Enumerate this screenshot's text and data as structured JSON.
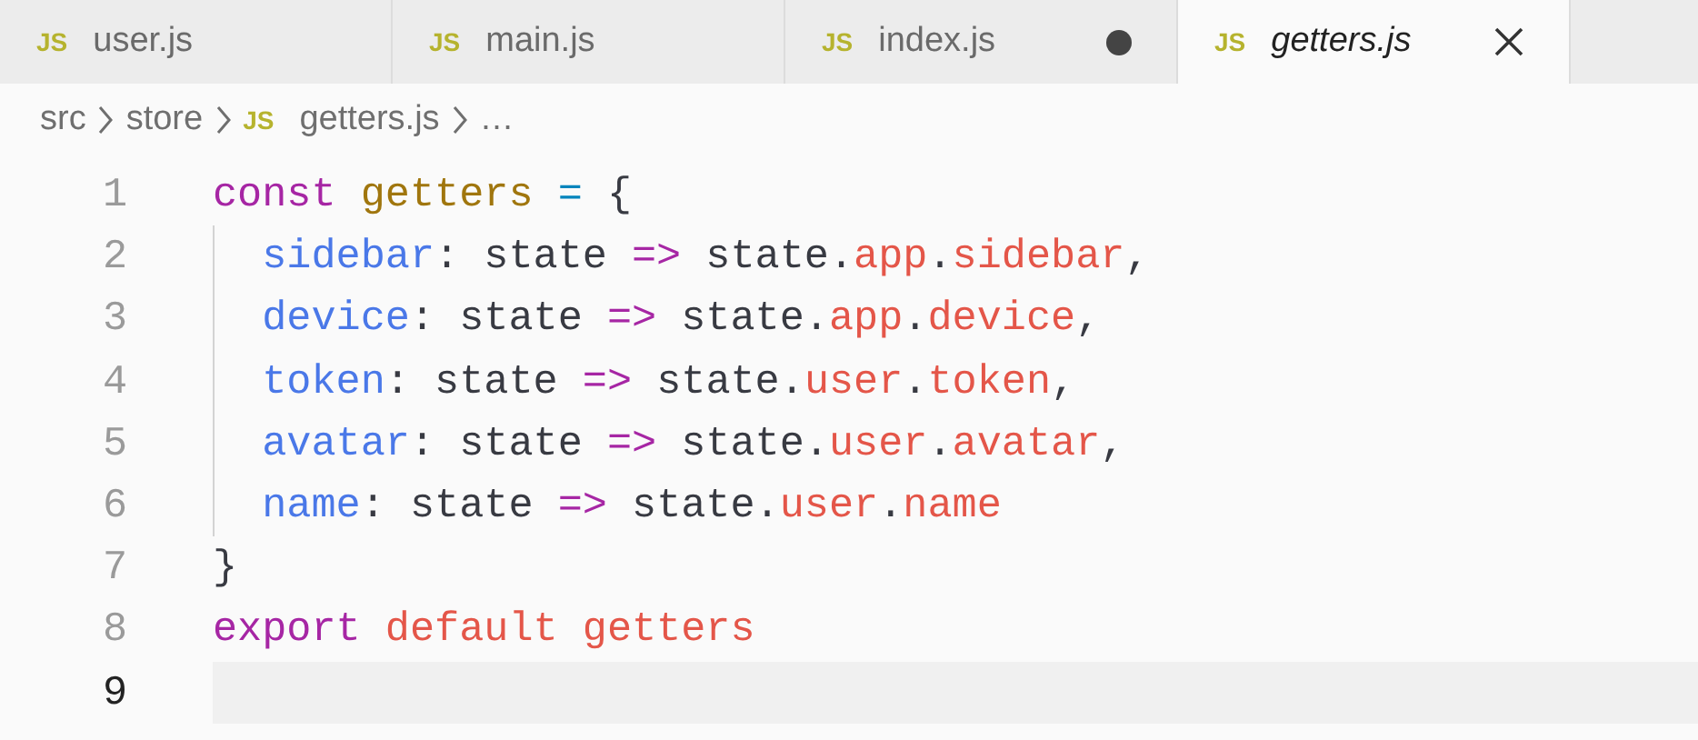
{
  "tabs": [
    {
      "icon": "JS",
      "label": "user.js",
      "selected": false,
      "dirty": false,
      "preview": false
    },
    {
      "icon": "JS",
      "label": "main.js",
      "selected": false,
      "dirty": false,
      "preview": false
    },
    {
      "icon": "JS",
      "label": "index.js",
      "selected": false,
      "dirty": true,
      "preview": false
    },
    {
      "icon": "JS",
      "label": "getters.js",
      "selected": true,
      "dirty": false,
      "preview": true
    }
  ],
  "breadcrumb": [
    {
      "kind": "folder",
      "label": "src"
    },
    {
      "kind": "folder",
      "label": "store"
    },
    {
      "kind": "file",
      "icon": "JS",
      "label": "getters.js"
    },
    {
      "kind": "more",
      "label": "…"
    }
  ],
  "editor": {
    "lines": [
      {
        "number": "1",
        "current": false,
        "tokens": [
          {
            "kind": "keyword",
            "text": "const"
          },
          {
            "kind": "entity",
            "text": " getters"
          },
          {
            "kind": "operator",
            "text": " ="
          },
          {
            "kind": "plain",
            "text": " {"
          }
        ]
      },
      {
        "number": "2",
        "current": false,
        "tokens": [
          {
            "kind": "property",
            "text": "  sidebar"
          },
          {
            "kind": "plain",
            "text": ": state "
          },
          {
            "kind": "keyword",
            "text": "=>"
          },
          {
            "kind": "plain",
            "text": " state."
          },
          {
            "kind": "variable",
            "text": "app"
          },
          {
            "kind": "plain",
            "text": "."
          },
          {
            "kind": "variable",
            "text": "sidebar"
          },
          {
            "kind": "plain",
            "text": ","
          }
        ]
      },
      {
        "number": "3",
        "current": false,
        "tokens": [
          {
            "kind": "property",
            "text": "  device"
          },
          {
            "kind": "plain",
            "text": ": state "
          },
          {
            "kind": "keyword",
            "text": "=>"
          },
          {
            "kind": "plain",
            "text": " state."
          },
          {
            "kind": "variable",
            "text": "app"
          },
          {
            "kind": "plain",
            "text": "."
          },
          {
            "kind": "variable",
            "text": "device"
          },
          {
            "kind": "plain",
            "text": ","
          }
        ]
      },
      {
        "number": "4",
        "current": false,
        "tokens": [
          {
            "kind": "property",
            "text": "  token"
          },
          {
            "kind": "plain",
            "text": ": state "
          },
          {
            "kind": "keyword",
            "text": "=>"
          },
          {
            "kind": "plain",
            "text": " state."
          },
          {
            "kind": "variable",
            "text": "user"
          },
          {
            "kind": "plain",
            "text": "."
          },
          {
            "kind": "variable",
            "text": "token"
          },
          {
            "kind": "plain",
            "text": ","
          }
        ]
      },
      {
        "number": "5",
        "current": false,
        "tokens": [
          {
            "kind": "property",
            "text": "  avatar"
          },
          {
            "kind": "plain",
            "text": ": state "
          },
          {
            "kind": "keyword",
            "text": "=>"
          },
          {
            "kind": "plain",
            "text": " state."
          },
          {
            "kind": "variable",
            "text": "user"
          },
          {
            "kind": "plain",
            "text": "."
          },
          {
            "kind": "variable",
            "text": "avatar"
          },
          {
            "kind": "plain",
            "text": ","
          }
        ]
      },
      {
        "number": "6",
        "current": false,
        "tokens": [
          {
            "kind": "property",
            "text": "  name"
          },
          {
            "kind": "plain",
            "text": ": state "
          },
          {
            "kind": "keyword",
            "text": "=>"
          },
          {
            "kind": "plain",
            "text": " state."
          },
          {
            "kind": "variable",
            "text": "user"
          },
          {
            "kind": "plain",
            "text": "."
          },
          {
            "kind": "variable",
            "text": "name"
          }
        ]
      },
      {
        "number": "7",
        "current": false,
        "tokens": [
          {
            "kind": "plain",
            "text": "}"
          }
        ]
      },
      {
        "number": "8",
        "current": false,
        "tokens": [
          {
            "kind": "keyword",
            "text": "export"
          },
          {
            "kind": "variable",
            "text": " default getters"
          }
        ]
      },
      {
        "number": "9",
        "current": true
      }
    ]
  }
}
